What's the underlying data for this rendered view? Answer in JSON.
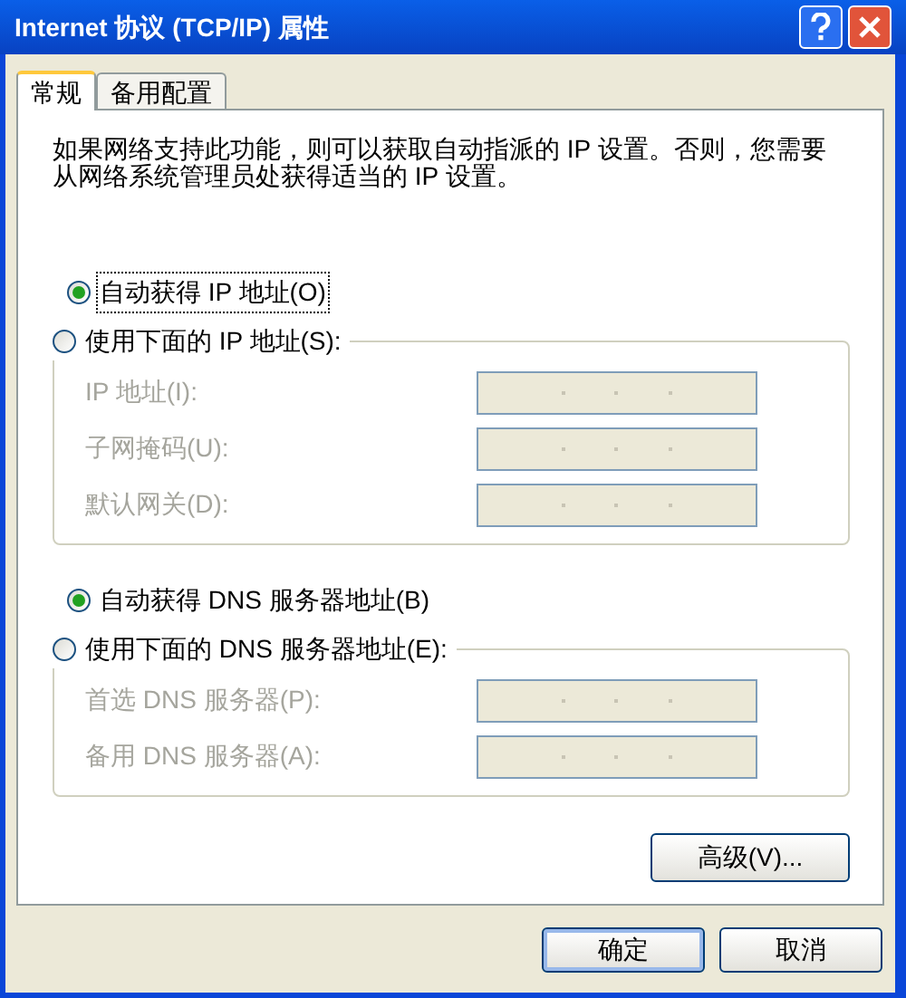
{
  "window": {
    "title": "Internet 协议 (TCP/IP) 属性"
  },
  "tabs": [
    {
      "label": "常规",
      "selected": true
    },
    {
      "label": "备用配置",
      "selected": false
    }
  ],
  "description": "如果网络支持此功能，则可以获取自动指派的 IP 设置。否则，您需要从网络系统管理员处获得适当的 IP 设置。",
  "ip_section": {
    "auto_option": {
      "label": "自动获得 IP 地址(O)",
      "selected": true,
      "focused": true
    },
    "manual_option": {
      "label": "使用下面的 IP 地址(S):",
      "selected": false
    },
    "fields": [
      {
        "label": "IP 地址(I):",
        "disabled": true
      },
      {
        "label": "子网掩码(U):",
        "disabled": true
      },
      {
        "label": "默认网关(D):",
        "disabled": true
      }
    ]
  },
  "dns_section": {
    "auto_option": {
      "label": "自动获得 DNS 服务器地址(B)",
      "selected": true,
      "focused": false
    },
    "manual_option": {
      "label": "使用下面的 DNS 服务器地址(E):",
      "selected": false
    },
    "fields": [
      {
        "label": "首选 DNS 服务器(P):",
        "disabled": true
      },
      {
        "label": "备用 DNS 服务器(A):",
        "disabled": true
      }
    ]
  },
  "advanced_button": "高级(V)...",
  "buttons": [
    {
      "label": "确定",
      "default": true
    },
    {
      "label": "取消",
      "default": false
    }
  ]
}
